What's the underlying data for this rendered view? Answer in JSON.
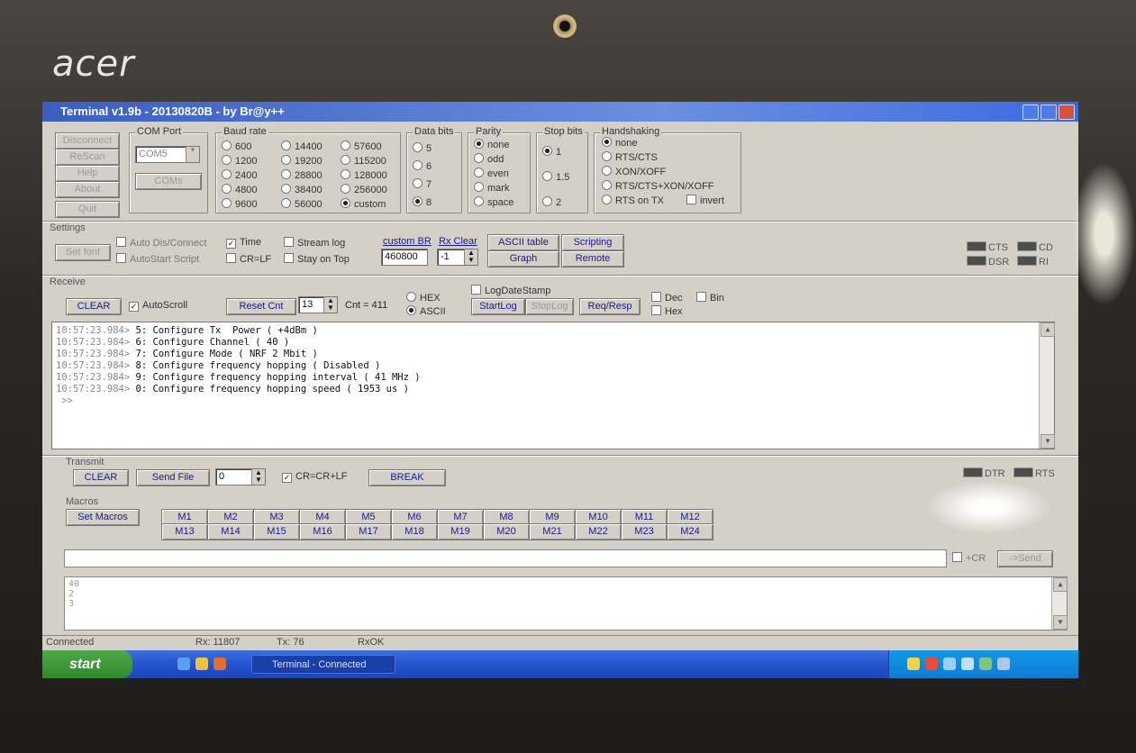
{
  "device": {
    "brand": "acer"
  },
  "window": {
    "title": "Terminal v1.9b - 20130820B - by Br@y++"
  },
  "top_buttons": {
    "disconnect": "Disconnect",
    "rescan": "ReScan",
    "help": "Help",
    "about": "About",
    "quit": "Quit"
  },
  "com_port": {
    "title": "COM Port",
    "value": "COM5",
    "coms_button": "COMs"
  },
  "baud": {
    "title": "Baud rate",
    "options": [
      "600",
      "1200",
      "2400",
      "4800",
      "9600",
      "14400",
      "19200",
      "28800",
      "38400",
      "56000",
      "57600",
      "115200",
      "128000",
      "256000",
      "custom"
    ],
    "selected": "custom"
  },
  "data_bits": {
    "title": "Data bits",
    "options": [
      "5",
      "6",
      "7",
      "8"
    ],
    "selected": "8"
  },
  "parity": {
    "title": "Parity",
    "options": [
      "none",
      "odd",
      "even",
      "mark",
      "space"
    ],
    "selected": "none"
  },
  "stop_bits": {
    "title": "Stop bits",
    "options": [
      "1",
      "1.5",
      "2"
    ],
    "selected": "1"
  },
  "handshaking": {
    "title": "Handshaking",
    "options": [
      "none",
      "RTS/CTS",
      "XON/XOFF",
      "RTS/CTS+XON/XOFF",
      "RTS on TX"
    ],
    "selected": "none",
    "invert": "invert"
  },
  "settings": {
    "title": "Settings",
    "set_font": "Set font",
    "auto_dis_connect": "Auto Dis/Connect",
    "autostart_script": "AutoStart Script",
    "time": "Time",
    "cr_lf": "CR=LF",
    "stream_log": "Stream log",
    "stay_on_top": "Stay on Top",
    "custom_br_label": "custom BR",
    "custom_br_value": "460800",
    "rx_clear_label": "Rx Clear",
    "rx_clear_value": "-1",
    "ascii_table": "ASCII table",
    "scripting": "Scripting",
    "graph": "Graph",
    "remote": "Remote",
    "leds": [
      "CTS",
      "CD",
      "DSR",
      "RI"
    ]
  },
  "receive": {
    "title": "Receive",
    "clear": "CLEAR",
    "autoscroll": "AutoScroll",
    "reset_cnt": "Reset Cnt",
    "cnt_spin": "13",
    "cnt_label": "Cnt = 411",
    "hex": "HEX",
    "ascii": "ASCII",
    "log_date_stamp": "LogDateStamp",
    "start_log": "StartLog",
    "stop_log": "StopLog",
    "req_resp": "Req/Resp",
    "dec": "Dec",
    "hex2": "Hex",
    "bin": "Bin"
  },
  "log_lines": [
    {
      "ts": "10:57:23.984>",
      "text": " 5: Configure Tx  Power ( +4dBm )"
    },
    {
      "ts": "10:57:23.984>",
      "text": " 6: Configure Channel ( 40 )"
    },
    {
      "ts": "10:57:23.984>",
      "text": " 7: Configure Mode ( NRF 2 Mbit )"
    },
    {
      "ts": "10:57:23.984>",
      "text": " 8: Configure frequency hopping ( Disabled )"
    },
    {
      "ts": "10:57:23.984>",
      "text": " 9: Configure frequency hopping interval ( 41 MHz )"
    },
    {
      "ts": "10:57:23.984>",
      "text": " 0: Configure frequency hopping speed ( 1953 us )"
    },
    {
      "ts": "",
      "text": " >>"
    }
  ],
  "transmit": {
    "title": "Transmit",
    "clear": "CLEAR",
    "send_file": "Send File",
    "spin_value": "0",
    "cr_crlf": "CR=CR+LF",
    "break": "BREAK",
    "leds": [
      "DTR",
      "RTS"
    ]
  },
  "macros": {
    "title": "Macros",
    "set_macros": "Set Macros",
    "row1": [
      "M1",
      "M2",
      "M3",
      "M4",
      "M5",
      "M6",
      "M7",
      "M8",
      "M9",
      "M10",
      "M11",
      "M12"
    ],
    "row2": [
      "M13",
      "M14",
      "M15",
      "M16",
      "M17",
      "M18",
      "M19",
      "M20",
      "M21",
      "M22",
      "M23",
      "M24"
    ]
  },
  "send_line": {
    "plus_cr": "+CR",
    "send": "->Send"
  },
  "tx_history": [
    "40",
    "2",
    "3"
  ],
  "status": {
    "connected": "Connected",
    "rx": "Rx: 11807",
    "tx": "Tx: 76",
    "rxok": "RxOK"
  },
  "taskbar": {
    "start": "start",
    "task": "Terminal - Connected"
  }
}
